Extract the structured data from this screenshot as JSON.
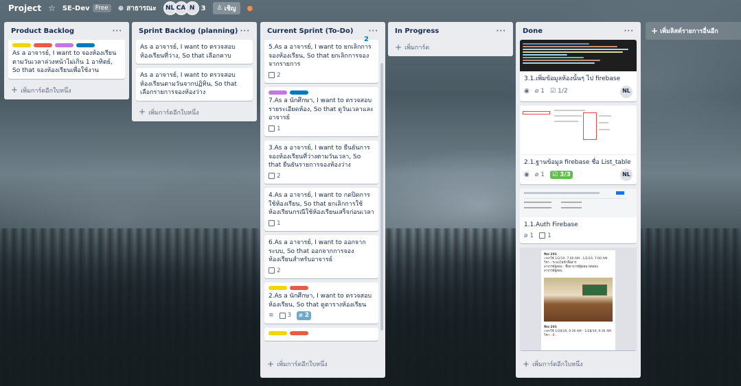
{
  "header": {
    "board_title": "Project",
    "team_name": "SE-Dev",
    "plan_badge": "Free",
    "visibility": "สาธารณะ",
    "members": [
      "NL",
      "CA",
      "N"
    ],
    "member_count": "3",
    "invite_label": "เชิญ"
  },
  "lists": [
    {
      "title": "Product Backlog",
      "add_label": "เพิ่มการ์ดอีกใบหนึ่ง",
      "cards": [
        {
          "text": "As a อาจารย์, I want to จองห้องเรียนตามวันเวลาล่วงหน้าไม่เกิน 1 อาทิตย์, So that จองห้องเรียนเพื่อใช้งาน",
          "labels": [
            "#f2d600",
            "#eb5a46",
            "#c377e0",
            "#0079bf"
          ]
        }
      ]
    },
    {
      "title": "Sprint Backlog (planning)",
      "add_label": "เพิ่มการ์ดอีกใบหนึ่ง",
      "cards": [
        {
          "text": "As a อาจารย์, I want to ตรวจสอบห้องเรียนที่ว่าง, So that เลือกคาบ"
        },
        {
          "text": "As a อาจารย์, I want to ตรวจสอบห้องเรียนตามวันจากปฏิทิน, So that เลือกรายการจองห้องว่าง"
        }
      ]
    },
    {
      "title": "Current Sprint (To-Do)",
      "count": "2",
      "add_label": "เพิ่มการ์ดอีกใบหนึ่ง",
      "cards": [
        {
          "text": "5.As a อาจารย์, I want to ยกเลิกการจองห้องเรียน, So that ยกเลิกการจองจากรายการ",
          "checklist": "2"
        },
        {
          "text": "7.As a นักศึกษา, I want to ตรวจสอบรายระเอียดห้อง, So that ดูวันเวลาและอาจารย์",
          "checklist": "1",
          "labels": [
            "#c377e0",
            "#0079bf"
          ]
        },
        {
          "text": "3.As a อาจารย์, I want to ยืนยันการจองห้องเรียนที่ว่างตามวันเวลา, So that ยืนยันรายการจองห้องว่าง",
          "checklist": "2"
        },
        {
          "text": "4.As a อาจารย์, I want to กดปิดการใช้ห้องเรียน, So that ยกเลิกการใช้ห้องเรียนกรณีใช้ห้องเรียนเสร็จก่อนเวลา",
          "checklist": "1"
        },
        {
          "text": "6.As a อาจารย์, I want to ออกจากระบบ, So that ออกจากการจองห้องเรียนสำหรับอาจารย์",
          "checklist": "2"
        },
        {
          "text": "2.As a นักศึกษา, I want to ตรวจสอบห้องเรียน, So that ดูตารางห้องเรียน",
          "checklist": "3",
          "attachments": "2",
          "labels": [
            "#f2d600",
            "#eb5a46"
          ]
        }
      ]
    },
    {
      "title": "In Progress",
      "add_label": "เพิ่มการ์ด",
      "cards": []
    },
    {
      "title": "Done",
      "add_label": "เพิ่มการ์ดอีกใบหนึ่ง",
      "cards": [
        {
          "text": "3.1.เพิ่มข้อมูลห้องนั้นๆ ไป firebase",
          "watch": "",
          "attachments": "1",
          "checklist": "1/2",
          "member": "NL"
        },
        {
          "text": "2.1.ฐานข้อมูล firebase ชื่อ List_table",
          "attachments": "1",
          "checklist": "3/3",
          "member": "NL"
        },
        {
          "text": "1.1.Auth Firebase",
          "attachments": "1",
          "checklist": "1"
        }
      ]
    }
  ],
  "room_doc": {
    "room": "ห้อง 201",
    "line1": "เวลาใช้ 1/2/19, 7:00 AM - 1/2/19, 7:00 AM",
    "line2": "วิชา : ระบบไฟฟ้าสื่อสาร",
    "line3": "อาจารย์ผู้สอน : ชื่ออาจารย์ผู้สอน ทดสอบ",
    "line4": "อาจารย์ผู้สอน",
    "room2": "ห้อง 201",
    "line5": "เวลาใช้ 1/28/19, 9:36 AM - 1/28/19, 9:36 AM",
    "line6": "วิชา : 0..."
  },
  "add_list_label": "เพิ่มลิสต์รายการอื่นอีก"
}
